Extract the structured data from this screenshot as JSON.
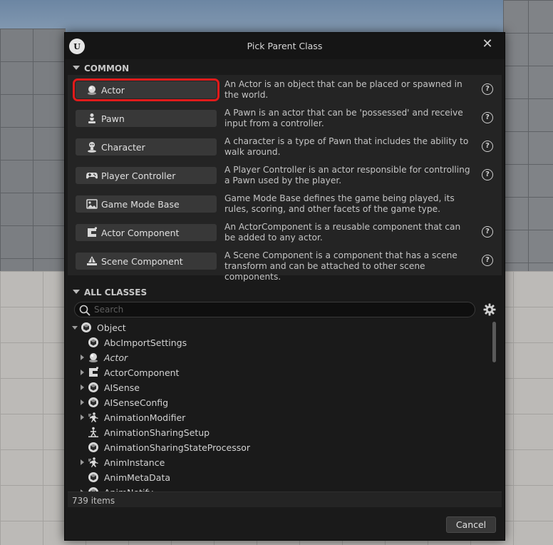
{
  "dialog": {
    "title": "Pick Parent Class",
    "close_icon": "close-icon",
    "logo_text": "U"
  },
  "common": {
    "header": "COMMON",
    "items": [
      {
        "label": "Actor",
        "icon": "actor-icon",
        "desc": "An Actor is an object that can be placed or spawned in the world.",
        "has_help": true,
        "highlighted": true
      },
      {
        "label": "Pawn",
        "icon": "pawn-icon",
        "desc": "A Pawn is an actor that can be 'possessed' and receive input from a controller.",
        "has_help": true
      },
      {
        "label": "Character",
        "icon": "character-icon",
        "desc": "A character is a type of Pawn that includes the ability to walk around.",
        "has_help": true
      },
      {
        "label": "Player Controller",
        "icon": "gamepad-icon",
        "desc": "A Player Controller is an actor responsible for controlling a Pawn used by the player.",
        "has_help": true
      },
      {
        "label": "Game Mode Base",
        "icon": "game-mode-icon",
        "desc": "Game Mode Base defines the game being played, its rules, scoring, and other facets of the game type.",
        "has_help": false
      },
      {
        "label": "Actor Component",
        "icon": "actor-component-icon",
        "desc": "An ActorComponent is a reusable component that can be added to any actor.",
        "has_help": true
      },
      {
        "label": "Scene Component",
        "icon": "scene-component-icon",
        "desc": "A Scene Component is a component that has a scene transform and can be attached to other scene components.",
        "has_help": true
      }
    ]
  },
  "all_classes": {
    "header": "ALL CLASSES",
    "search_placeholder": "Search",
    "items": [
      {
        "label": "Object",
        "icon": "object-icon",
        "depth": 0,
        "expander": "open",
        "italic": false
      },
      {
        "label": "AbcImportSettings",
        "icon": "object-icon",
        "depth": 1,
        "expander": "none",
        "italic": false
      },
      {
        "label": "Actor",
        "icon": "actor-icon",
        "depth": 1,
        "expander": "closed",
        "italic": true
      },
      {
        "label": "ActorComponent",
        "icon": "actor-component-icon",
        "depth": 1,
        "expander": "closed",
        "italic": false
      },
      {
        "label": "AISense",
        "icon": "object-icon",
        "depth": 1,
        "expander": "closed",
        "italic": false
      },
      {
        "label": "AISenseConfig",
        "icon": "object-icon",
        "depth": 1,
        "expander": "closed",
        "italic": false
      },
      {
        "label": "AnimationModifier",
        "icon": "animation-icon",
        "depth": 1,
        "expander": "closed",
        "italic": false
      },
      {
        "label": "AnimationSharingSetup",
        "icon": "animation-sharing-icon",
        "depth": 1,
        "expander": "none",
        "italic": false
      },
      {
        "label": "AnimationSharingStateProcessor",
        "icon": "object-icon",
        "depth": 1,
        "expander": "none",
        "italic": false
      },
      {
        "label": "AnimInstance",
        "icon": "animation-icon",
        "depth": 1,
        "expander": "closed",
        "italic": false
      },
      {
        "label": "AnimMetaData",
        "icon": "object-icon",
        "depth": 1,
        "expander": "none",
        "italic": false
      },
      {
        "label": "AnimNotify",
        "icon": "object-icon",
        "depth": 1,
        "expander": "closed",
        "italic": false
      }
    ]
  },
  "status": {
    "item_count": "739 items"
  },
  "footer": {
    "cancel_label": "Cancel"
  }
}
